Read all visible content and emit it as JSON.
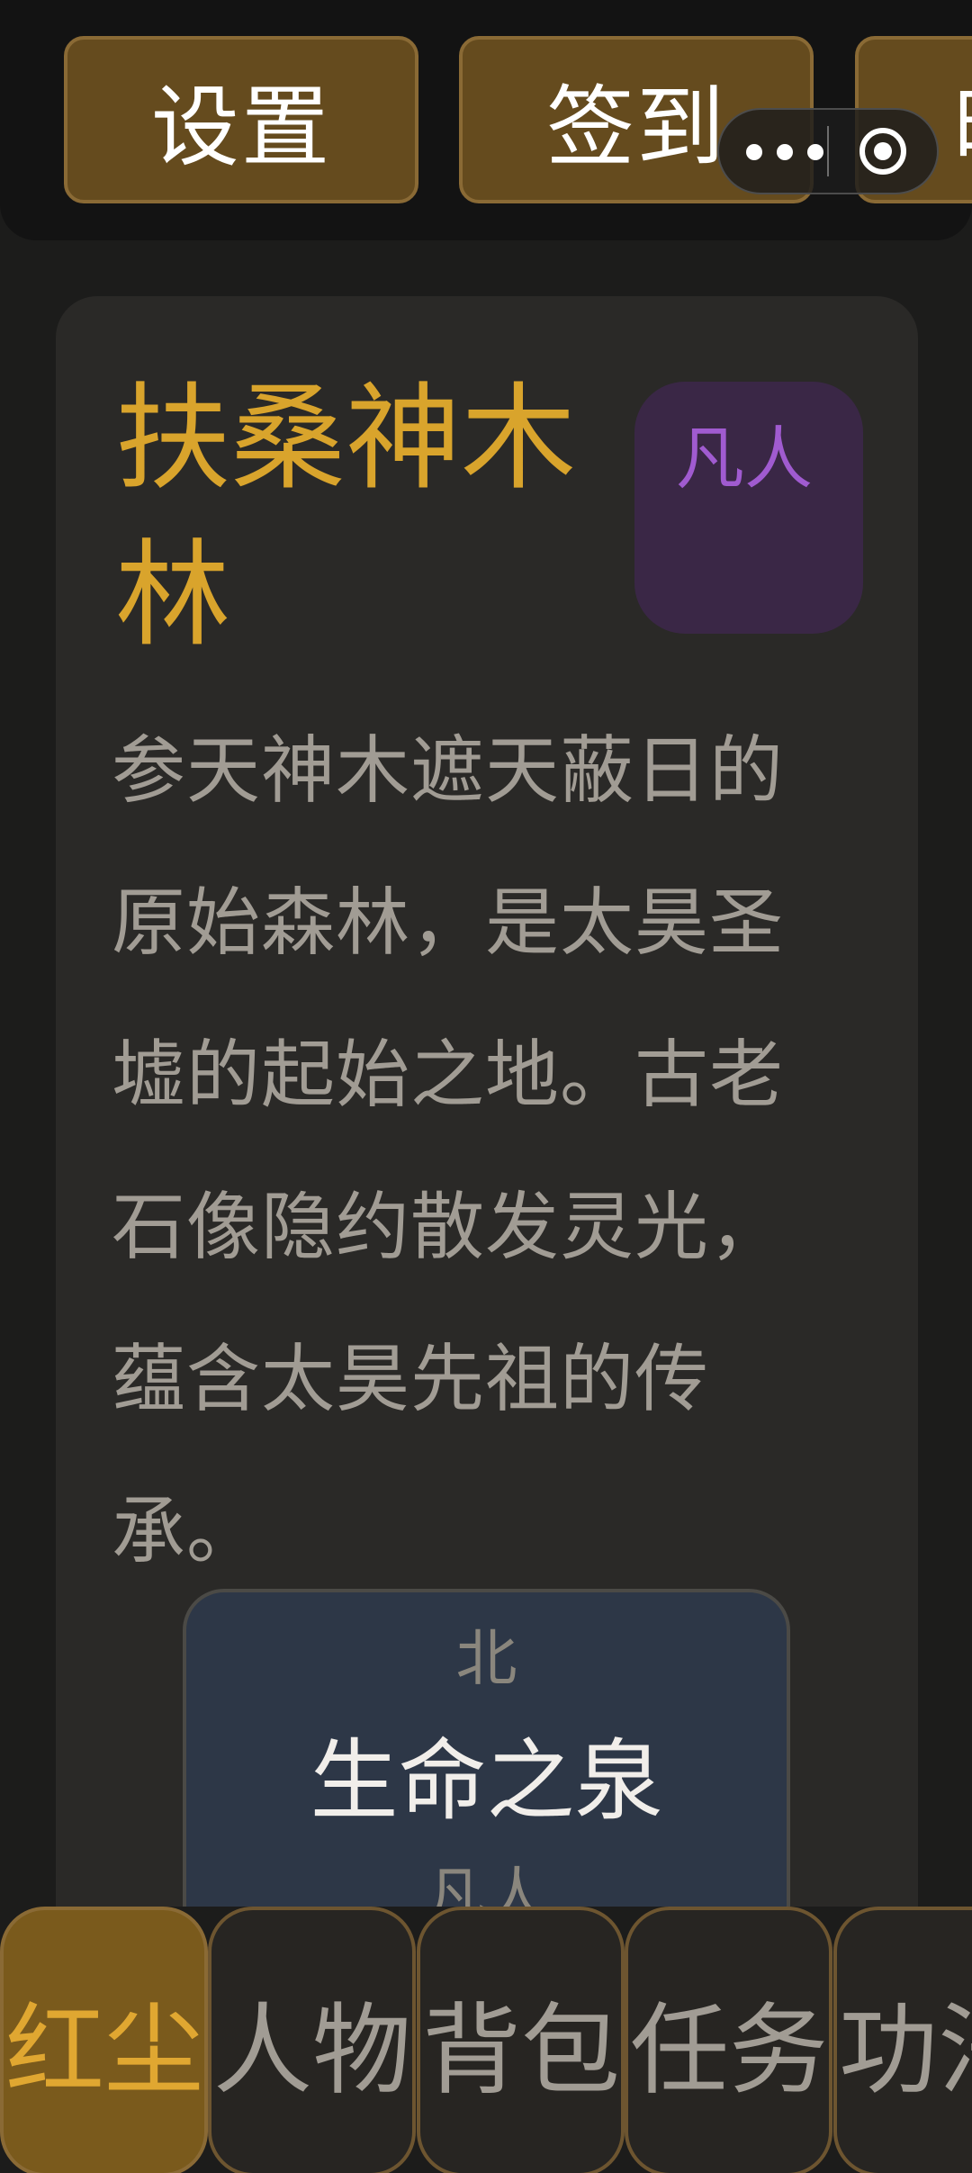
{
  "header": {
    "settings_label": "设置",
    "checkin_label": "签到",
    "partial_label": "时"
  },
  "location": {
    "title": "扶桑神木林",
    "realm_badge": "凡人",
    "description": "参天神木遮天蔽日的原始森林，是太昊圣墟的起始之地。古老石像隐约散发灵光，蕴含太昊先祖的传承。"
  },
  "exit_node": {
    "direction": "北",
    "name": "生命之泉",
    "realm": "凡人"
  },
  "bottom_nav": {
    "tabs": [
      {
        "label": "红尘"
      },
      {
        "label": "人物"
      },
      {
        "label": "背包"
      },
      {
        "label": "任务"
      },
      {
        "label": "功法"
      }
    ]
  },
  "colors": {
    "accent_gold": "#d9a42c",
    "realm_purple": "#a05bd0",
    "button_brown": "#654b1e",
    "card_bg": "#2a2927",
    "node_bg": "#2d3747"
  }
}
